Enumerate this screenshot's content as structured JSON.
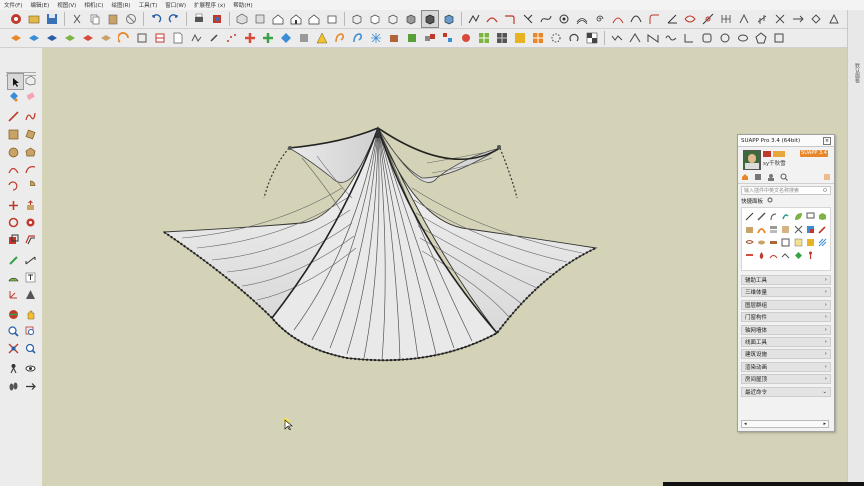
{
  "menubar": {
    "items": [
      "文件(F)",
      "编辑(E)",
      "视图(V)",
      "相机(C)",
      "绘图(R)",
      "工具(T)",
      "窗口(W)",
      "扩展程序 (x)",
      "帮助(H)"
    ]
  },
  "right_tray_label": "默认面板",
  "suapp": {
    "title": "SUAPP Pro 3.4 (64bit)",
    "close_glyph": "×",
    "user_name": "sy千秋雪",
    "pro_button": "SUAPP 3.4",
    "search_placeholder": "输入插件中英文名称搜索",
    "quick_panel_label": "快捷面板",
    "categories": [
      "辅助工具",
      "三维体量",
      "图层群组",
      "门窗构件",
      "轴网墙体",
      "线面工具",
      "建筑设施",
      "渲染动画",
      "房间屋顶",
      "最近命令"
    ]
  },
  "colors": {
    "viewport_bg": "#d4d3b7",
    "accent_orange": "#e8862a",
    "panel_bg": "#f2f2f2"
  }
}
